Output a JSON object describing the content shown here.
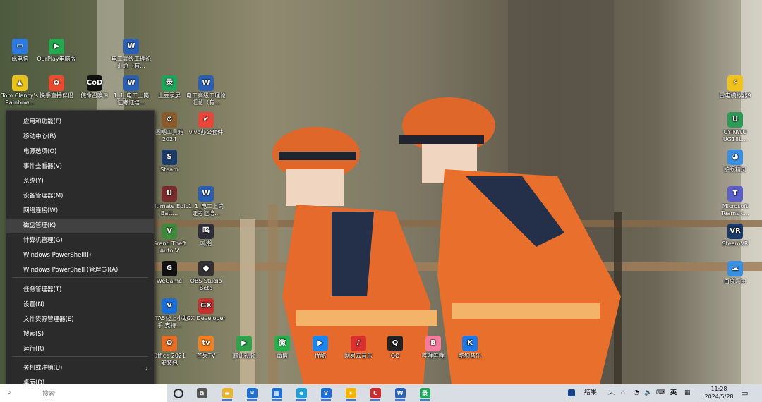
{
  "desktop": {
    "icons": [
      {
        "label": "此电脑",
        "color": "#2d7be0",
        "glyph": "▭"
      },
      {
        "label": "OurPlay电脑版",
        "color": "#25a84f",
        "glyph": "▶"
      },
      {
        "label": "电工高级工理论汇总（有...",
        "color": "#2b5fb3",
        "glyph": "W"
      },
      {
        "label": "Tom Clancy's Rainbow...",
        "color": "#e9c21b",
        "glyph": "▲"
      },
      {
        "label": "快手直播伴侣",
        "color": "#e94b2f",
        "glyph": "✿"
      },
      {
        "label": "使命召唤®",
        "color": "#111111",
        "glyph": "CoD"
      },
      {
        "label": "1_1_电工上岗证考证培...",
        "color": "#2b5fb3",
        "glyph": "W"
      },
      {
        "label": "土豆录屏",
        "color": "#1fa45b",
        "glyph": "录"
      },
      {
        "label": "电工高级工理论汇总（有...",
        "color": "#2b5fb3",
        "glyph": "W"
      },
      {
        "label": "图吧工具箱2024",
        "color": "#8a5a2b",
        "glyph": "⚙"
      },
      {
        "label": "vivo办公套件",
        "color": "#e9463a",
        "glyph": "✔"
      },
      {
        "label": "Steam",
        "color": "#1b3b6a",
        "glyph": "S"
      },
      {
        "label": "Ultimate Epic Batt...",
        "color": "#7a2c2c",
        "glyph": "U"
      },
      {
        "label": "1_1_电工上岗证考证培...",
        "color": "#2b5fb3",
        "glyph": "W"
      },
      {
        "label": "Grand Theft Auto V",
        "color": "#3f8a3a",
        "glyph": "V"
      },
      {
        "label": "鸣潮",
        "color": "#2e2e3a",
        "glyph": "鸣"
      },
      {
        "label": "WeGame",
        "color": "#111111",
        "glyph": "G"
      },
      {
        "label": "OBS Studio Beta",
        "color": "#333333",
        "glyph": "●"
      },
      {
        "label": "GTA5线上小助手 支持...",
        "color": "#1b6ed8",
        "glyph": "V"
      },
      {
        "label": "GX Developer",
        "color": "#c9302c",
        "glyph": "GX"
      },
      {
        "label": "Office 2021 安装包",
        "color": "#e56d24",
        "glyph": "O"
      },
      {
        "label": "芒果TV",
        "color": "#f08020",
        "glyph": "tv"
      },
      {
        "label": "腾讯视频",
        "color": "#31a24c",
        "glyph": "▶"
      },
      {
        "label": "微信",
        "color": "#24b04a",
        "glyph": "微"
      },
      {
        "label": "优酷",
        "color": "#1b86f0",
        "glyph": "▶"
      },
      {
        "label": "网易云音乐",
        "color": "#d8302f",
        "glyph": "♪"
      },
      {
        "label": "QQ",
        "color": "#222222",
        "glyph": "Q"
      },
      {
        "label": "哔哩哔哩",
        "color": "#f57ca0",
        "glyph": "B"
      },
      {
        "label": "酷狗音乐",
        "color": "#1e78e6",
        "glyph": "K"
      },
      {
        "label": "雷电模拟器9",
        "color": "#f1c21b",
        "glyph": "⚡"
      },
      {
        "label": "UYINWU UG18L...",
        "color": "#2d9a57",
        "glyph": "U"
      },
      {
        "label": "护眼精灵",
        "color": "#3b8fe0",
        "glyph": "◕"
      },
      {
        "label": "Microsoft Teams c...",
        "color": "#5b5fc7",
        "glyph": "T"
      },
      {
        "label": "SteamVR",
        "color": "#1b3b6a",
        "glyph": "VR"
      },
      {
        "label": "百度网盘",
        "color": "#3b8fe0",
        "glyph": "☁"
      }
    ]
  },
  "context_menu": {
    "items": [
      {
        "label": "应用和功能(F)"
      },
      {
        "label": "移动中心(B)"
      },
      {
        "label": "电源选项(O)"
      },
      {
        "label": "事件查看器(V)"
      },
      {
        "label": "系统(Y)"
      },
      {
        "label": "设备管理器(M)"
      },
      {
        "label": "网络连接(W)"
      },
      {
        "label": "磁盘管理(K)"
      },
      {
        "label": "计算机管理(G)"
      },
      {
        "label": "Windows PowerShell(I)"
      },
      {
        "label": "Windows PowerShell (管理员)(A)"
      },
      {
        "label": "任务管理器(T)"
      },
      {
        "label": "设置(N)"
      },
      {
        "label": "文件资源管理器(E)"
      },
      {
        "label": "搜索(S)"
      },
      {
        "label": "运行(R)"
      },
      {
        "label": "关机或注销(U)"
      },
      {
        "label": "桌面(D)"
      }
    ],
    "highlighted": "磁盘管理(K)"
  },
  "taskbar": {
    "search_text": "搜索",
    "apps": [
      {
        "name": "task-view",
        "color": "#555555",
        "glyph": "⧉"
      },
      {
        "name": "file-explorer",
        "color": "#e8b62b",
        "glyph": "▬"
      },
      {
        "name": "mail",
        "color": "#1f6fd1",
        "glyph": "✉"
      },
      {
        "name": "store",
        "color": "#1f6fd1",
        "glyph": "▦"
      },
      {
        "name": "edge",
        "color": "#1e9fd8",
        "glyph": "e"
      },
      {
        "name": "tools",
        "color": "#1b6ed8",
        "glyph": "V"
      },
      {
        "name": "weather",
        "color": "#f4b400",
        "glyph": "☀"
      },
      {
        "name": "cod",
        "color": "#cc2b2b",
        "glyph": "C"
      },
      {
        "name": "word",
        "color": "#2b5fb3",
        "glyph": "W"
      },
      {
        "name": "recorder",
        "color": "#1fa45b",
        "glyph": "录"
      }
    ],
    "tray": {
      "news_label": "结果",
      "ime": "英",
      "time": "11:28",
      "date": "2024/5/28"
    }
  },
  "colors": {
    "menu_bg": "#2b2b2b",
    "menu_highlight": "#414141",
    "taskbar_bg": "#d9dde4"
  }
}
